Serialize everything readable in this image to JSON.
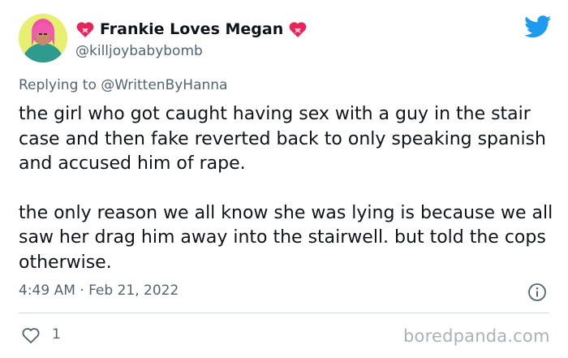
{
  "user": {
    "display_name": "Frankie Loves Megan",
    "handle": "@killjoybabybomb"
  },
  "icons": {
    "avatar": "avatar-photo",
    "name_prefix": "heart-with-ribbon-icon",
    "name_suffix": "heart-with-ribbon-icon",
    "platform": "twitter-bird-icon",
    "info": "info-icon",
    "like": "heart-outline-icon"
  },
  "reply": {
    "prefix": "Replying to",
    "mention": "@WrittenByHanna"
  },
  "tweet": {
    "paragraphs": [
      "the girl who got caught having sex with a guy in the stair case and then fake reverted back to only speaking spanish and accused him of rape.",
      "the only reason we all know she was lying is because we all saw her drag him away into the stairwell. but told the cops otherwise."
    ],
    "timestamp": "4:49 AM · Feb 21, 2022"
  },
  "stats": {
    "likes": "1"
  },
  "watermark": "boredpanda.com",
  "colors": {
    "twitter_blue": "#1d9bf0",
    "secondary_text": "#536471",
    "heart_red": "#e8245a"
  }
}
